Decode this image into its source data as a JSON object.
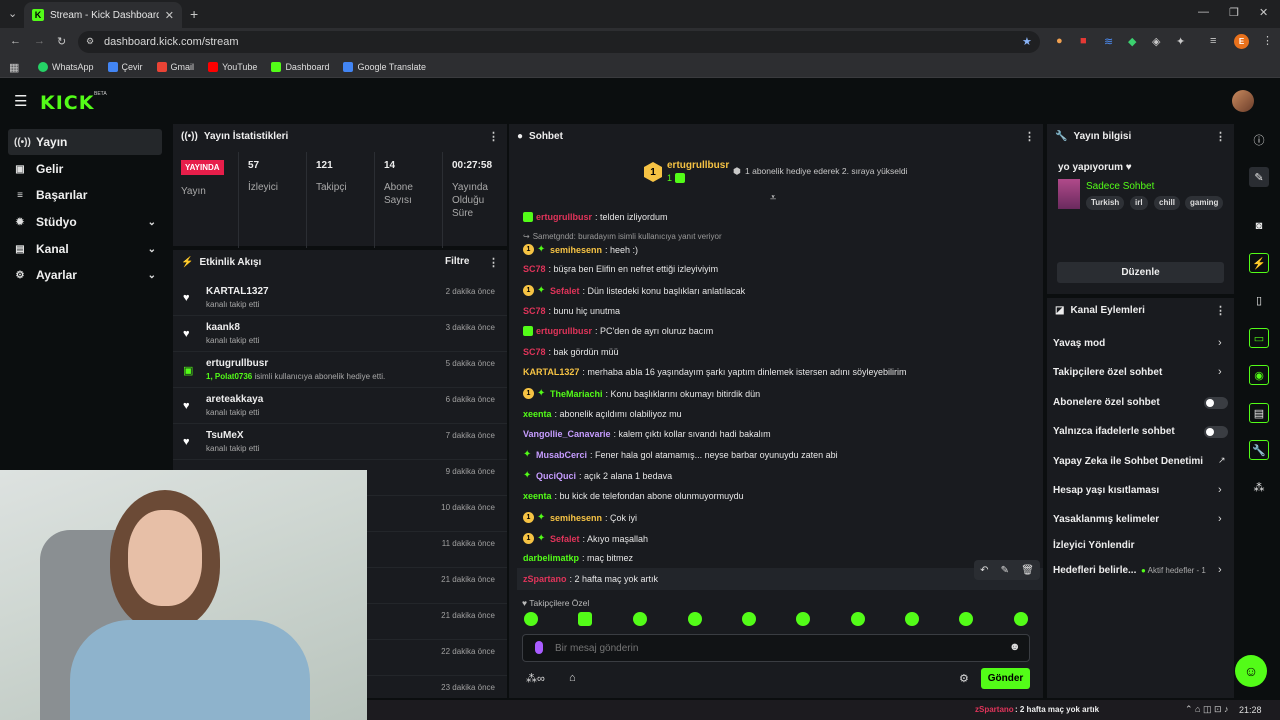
{
  "browser": {
    "tab_title": "Stream - Kick Dashboard",
    "url": "dashboard.kick.com/stream",
    "bookmarks": [
      "WhatsApp",
      "Çevir",
      "Gmail",
      "YouTube",
      "Dashboard",
      "Google Translate"
    ],
    "profile_initial": "E"
  },
  "app": {
    "logo": "KICK",
    "beta": "BETA"
  },
  "nav": [
    "Yayın",
    "Gelir",
    "Başarılar",
    "Stüdyo",
    "Kanal",
    "Ayarlar"
  ],
  "stats": {
    "title": "Yayın İstatistikleri",
    "live_badge": "YAYINDA",
    "live_label": "Yayın",
    "items": [
      {
        "value": "57",
        "label": "İzleyici"
      },
      {
        "value": "121",
        "label": "Takipçi"
      },
      {
        "value": "14",
        "label": "Abone Sayısı"
      },
      {
        "value": "00:27:58",
        "label": "Yayında Olduğu Süre"
      }
    ]
  },
  "activity": {
    "title": "Etkinlik Akışı",
    "filter": "Filtre",
    "items": [
      {
        "name": "KARTAL1327",
        "sub": "kanalı takip etti",
        "time": "2 dakika önce"
      },
      {
        "name": "kaank8",
        "sub": "kanalı takip etti",
        "time": "3 dakika önce"
      },
      {
        "name": "ertugrullbusr",
        "sub_hl": "1, Polat0736",
        "sub": " isimli kullanıcıya abonelik hediye etti.",
        "time": "5 dakika önce"
      },
      {
        "name": "areteakkaya",
        "sub": "kanalı takip etti",
        "time": "6 dakika önce"
      },
      {
        "name": "TsuMeX",
        "sub": "kanalı takip etti",
        "time": "7 dakika önce"
      }
    ],
    "more_times": [
      "9 dakika önce",
      "10 dakika önce",
      "11 dakika önce",
      "21 dakika önce",
      "21 dakika önce",
      "22 dakika önce",
      "23 dakika önce"
    ]
  },
  "chat": {
    "title": "Sohbet",
    "pinned_user": "ertugrullbusr",
    "pinned_count": "1",
    "pinned_text": "1 abonelik hediye ederek 2. sıraya yükseldi",
    "reply_note": "Sametgndd: buradayım isimli kullanıcıya yanıt veriyor",
    "messages": [
      {
        "user": "ertugrullbusr",
        "text": ": telden izliyordum",
        "color": "#e0345a"
      },
      {
        "user": "semihesenn",
        "text": ": heeh :)",
        "color": "#f6c344"
      },
      {
        "user": "SC78",
        "text": ": büşra ben Elifin en nefret ettiği izleyiviyim",
        "color": "#e0345a"
      },
      {
        "user": "Sefalet",
        "text": ": Dün listedeki konu başlıkları anlatılacak",
        "color": "#e0345a"
      },
      {
        "user": "SC78",
        "text": ": bunu hiç unutma",
        "color": "#e0345a"
      },
      {
        "user": "ertugrullbusr",
        "text": ": PC'den de ayrı oluruz bacım",
        "color": "#e0345a"
      },
      {
        "user": "SC78",
        "text": ": bak gördün müü",
        "color": "#e0345a"
      },
      {
        "user": "KARTAL1327",
        "text": ": merhaba abla 16 yaşındayım şarkı yaptım dinlemek istersen adını söyleyebilirim",
        "color": "#f6c344"
      },
      {
        "user": "TheMariachi",
        "text": ": Konu başlıklarını okumayı bitirdik dün",
        "color": "#53fc18"
      },
      {
        "user": "xeenta",
        "text": ": abonelik açıldımı olabiliyoz mu",
        "color": "#53fc18"
      },
      {
        "user": "Vangollie_Canavarie",
        "text": ": kalem çıktı kollar sıvandı hadi bakalım",
        "color": "#c69cff"
      },
      {
        "user": "MusabCerci",
        "text": ": Fener hala gol atamamış... neyse barbar oyunuydu zaten abi",
        "color": "#c69cff"
      },
      {
        "user": "QuciQuci",
        "text": ": açık 2 alana 1 bedava",
        "color": "#c69cff"
      },
      {
        "user": "xeenta",
        "text": ": bu kick de telefondan abone olunmuyormuydu",
        "color": "#53fc18"
      },
      {
        "user": "semihesenn",
        "text": ": Çok iyi",
        "color": "#f6c344"
      },
      {
        "user": "Sefalet",
        "text": ": Akıyo maşallah",
        "color": "#e0345a"
      },
      {
        "user": "darbelimatkp",
        "text": ": maç bitmez",
        "color": "#53fc18"
      },
      {
        "user": "zSpartano",
        "text": ": 2 hafta maç yok artık",
        "color": "#e0345a"
      }
    ],
    "followers_only": "Takipçilere Özel",
    "input_placeholder": "Bir mesaj gönderin",
    "send_label": "Gönder"
  },
  "stream_info": {
    "title": "Yayın bilgisi",
    "stream_title": "yo yapıyorum ♥",
    "category": "Sadece Sohbet",
    "tags": [
      "Turkish",
      "irl",
      "chill",
      "gaming"
    ],
    "edit_label": "Düzenle"
  },
  "channel_actions": {
    "title": "Kanal Eylemleri",
    "items": [
      {
        "label": "Yavaş mod",
        "control": "chevron"
      },
      {
        "label": "Takipçilere özel sohbet",
        "control": "chevron"
      },
      {
        "label": "Abonelere özel sohbet",
        "control": "toggle"
      },
      {
        "label": "Yalnızca ifadelerle sohbet",
        "control": "toggle"
      },
      {
        "label": "Yapay Zeka ile Sohbet Denetimi",
        "control": "external"
      },
      {
        "label": "Hesap yaşı kısıtlaması",
        "control": "chevron"
      },
      {
        "label": "Yasaklanmış kelimeler",
        "control": "chevron"
      },
      {
        "label": "İzleyici Yönlendir",
        "control": "none"
      },
      {
        "label": "Hedefleri belirle...",
        "control": "chevron"
      }
    ],
    "goal_status": "Aktif hedefler - 1"
  },
  "taskbar": {
    "ticker_user": "zSpartano",
    "ticker_text": ": 2 hafta maç yok artık",
    "clock": "21:28"
  }
}
